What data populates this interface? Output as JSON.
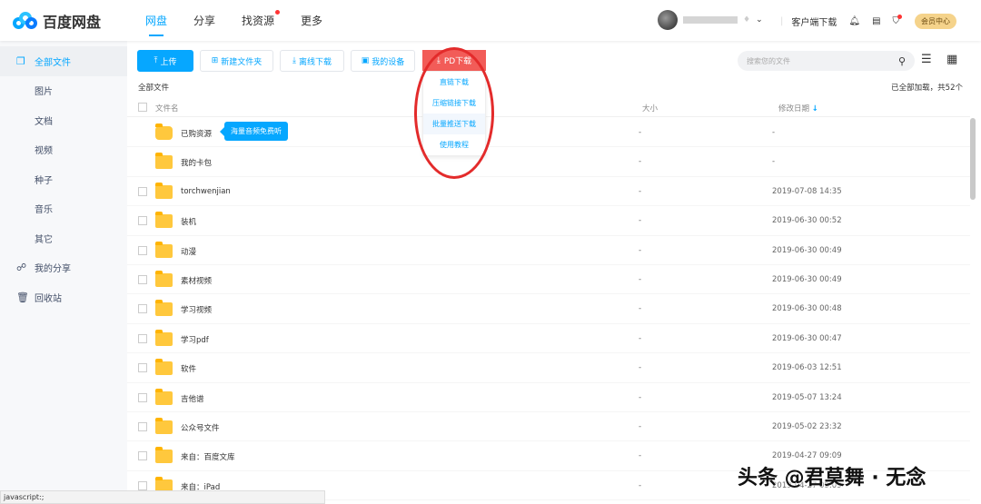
{
  "header": {
    "brand": "百度网盘",
    "nav": [
      {
        "label": "网盘",
        "active": true
      },
      {
        "label": "分享"
      },
      {
        "label": "找资源",
        "dot": true
      },
      {
        "label": "更多"
      }
    ],
    "client_download": "客户端下载",
    "vip": "会员中心"
  },
  "sidebar": {
    "items": [
      "全部文件",
      "图片",
      "文档",
      "视频",
      "种子",
      "音乐",
      "其它",
      "我的分享",
      "回收站"
    ]
  },
  "toolbar": {
    "upload": "上传",
    "new_folder": "新建文件夹",
    "offline": "离线下载",
    "devices": "我的设备",
    "pd": "PD下载",
    "pd_menu": [
      "直链下载",
      "压缩链接下载",
      "批量推送下载",
      "使用教程"
    ],
    "search_placeholder": "搜索您的文件"
  },
  "list": {
    "breadcrumb": "全部文件",
    "loaded": "已全部加载，共52个",
    "col_name": "文件名",
    "col_size": "大小",
    "col_date": "修改日期",
    "tooltip": "海量音频免费听",
    "rows": [
      {
        "name": "已购资源",
        "size": "-",
        "date": "-"
      },
      {
        "name": "我的卡包",
        "size": "-",
        "date": "-"
      },
      {
        "name": "torchwenjian",
        "size": "-",
        "date": "2019-07-08 14:35"
      },
      {
        "name": "装机",
        "size": "-",
        "date": "2019-06-30 00:52"
      },
      {
        "name": "动漫",
        "size": "-",
        "date": "2019-06-30 00:49"
      },
      {
        "name": "素材视频",
        "size": "-",
        "date": "2019-06-30 00:49"
      },
      {
        "name": "学习视频",
        "size": "-",
        "date": "2019-06-30 00:48"
      },
      {
        "name": "学习pdf",
        "size": "-",
        "date": "2019-06-30 00:47"
      },
      {
        "name": "软件",
        "size": "-",
        "date": "2019-06-03 12:51"
      },
      {
        "name": "吉他谱",
        "size": "-",
        "date": "2019-05-07 13:24"
      },
      {
        "name": "公众号文件",
        "size": "-",
        "date": "2019-05-02 23:32"
      },
      {
        "name": "来自：百度文库",
        "size": "-",
        "date": "2019-04-27 09:09"
      },
      {
        "name": "来自：iPad",
        "size": "-",
        "date": "2019-04-27 09:09"
      }
    ]
  },
  "status_bar": "javascript:;",
  "watermark": "头条 @君莫舞 · 无念"
}
